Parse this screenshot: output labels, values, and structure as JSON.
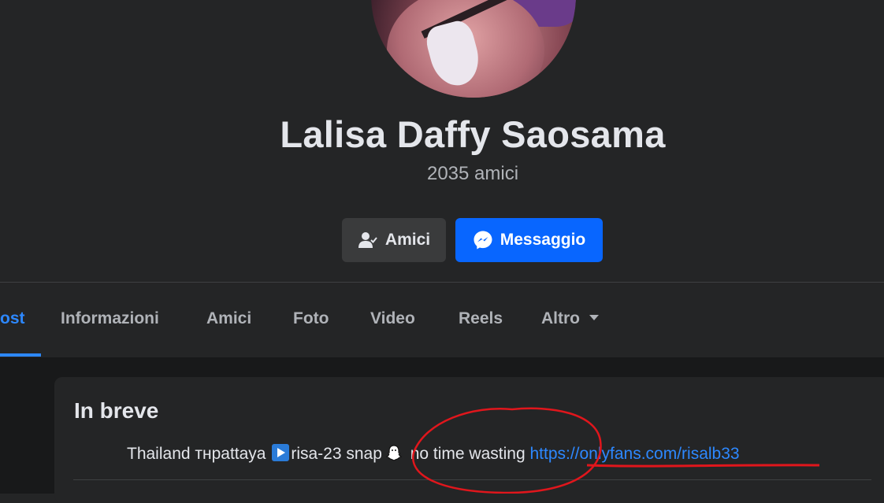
{
  "profile": {
    "name": "Lalisa Daffy Saosama",
    "friends_count": "2035 amici"
  },
  "actions": {
    "friends_label": "Amici",
    "message_label": "Messaggio"
  },
  "tabs": [
    {
      "label": "ost",
      "active": true
    },
    {
      "label": "Informazioni",
      "active": false
    },
    {
      "label": "Amici",
      "active": false
    },
    {
      "label": "Foto",
      "active": false
    },
    {
      "label": "Video",
      "active": false
    },
    {
      "label": "Reels",
      "active": false
    },
    {
      "label": "Altro",
      "active": false
    }
  ],
  "intro": {
    "title": "In breve",
    "bio_part1": "Thailand тнpattaya ",
    "bio_part2": "risa-23 snap",
    "bio_part3": " no time wasting ",
    "bio_link": "https://onlyfans.com/risalb33"
  },
  "colors": {
    "accent": "#2d88ff",
    "message_button": "#0866ff",
    "annotation_red": "#e0161c"
  },
  "icons": {
    "friends": "person-check-icon",
    "message": "messenger-icon",
    "more": "caret-down-icon",
    "bio_play": "play-button-icon",
    "bio_snap": "snapchat-ghost-icon"
  }
}
